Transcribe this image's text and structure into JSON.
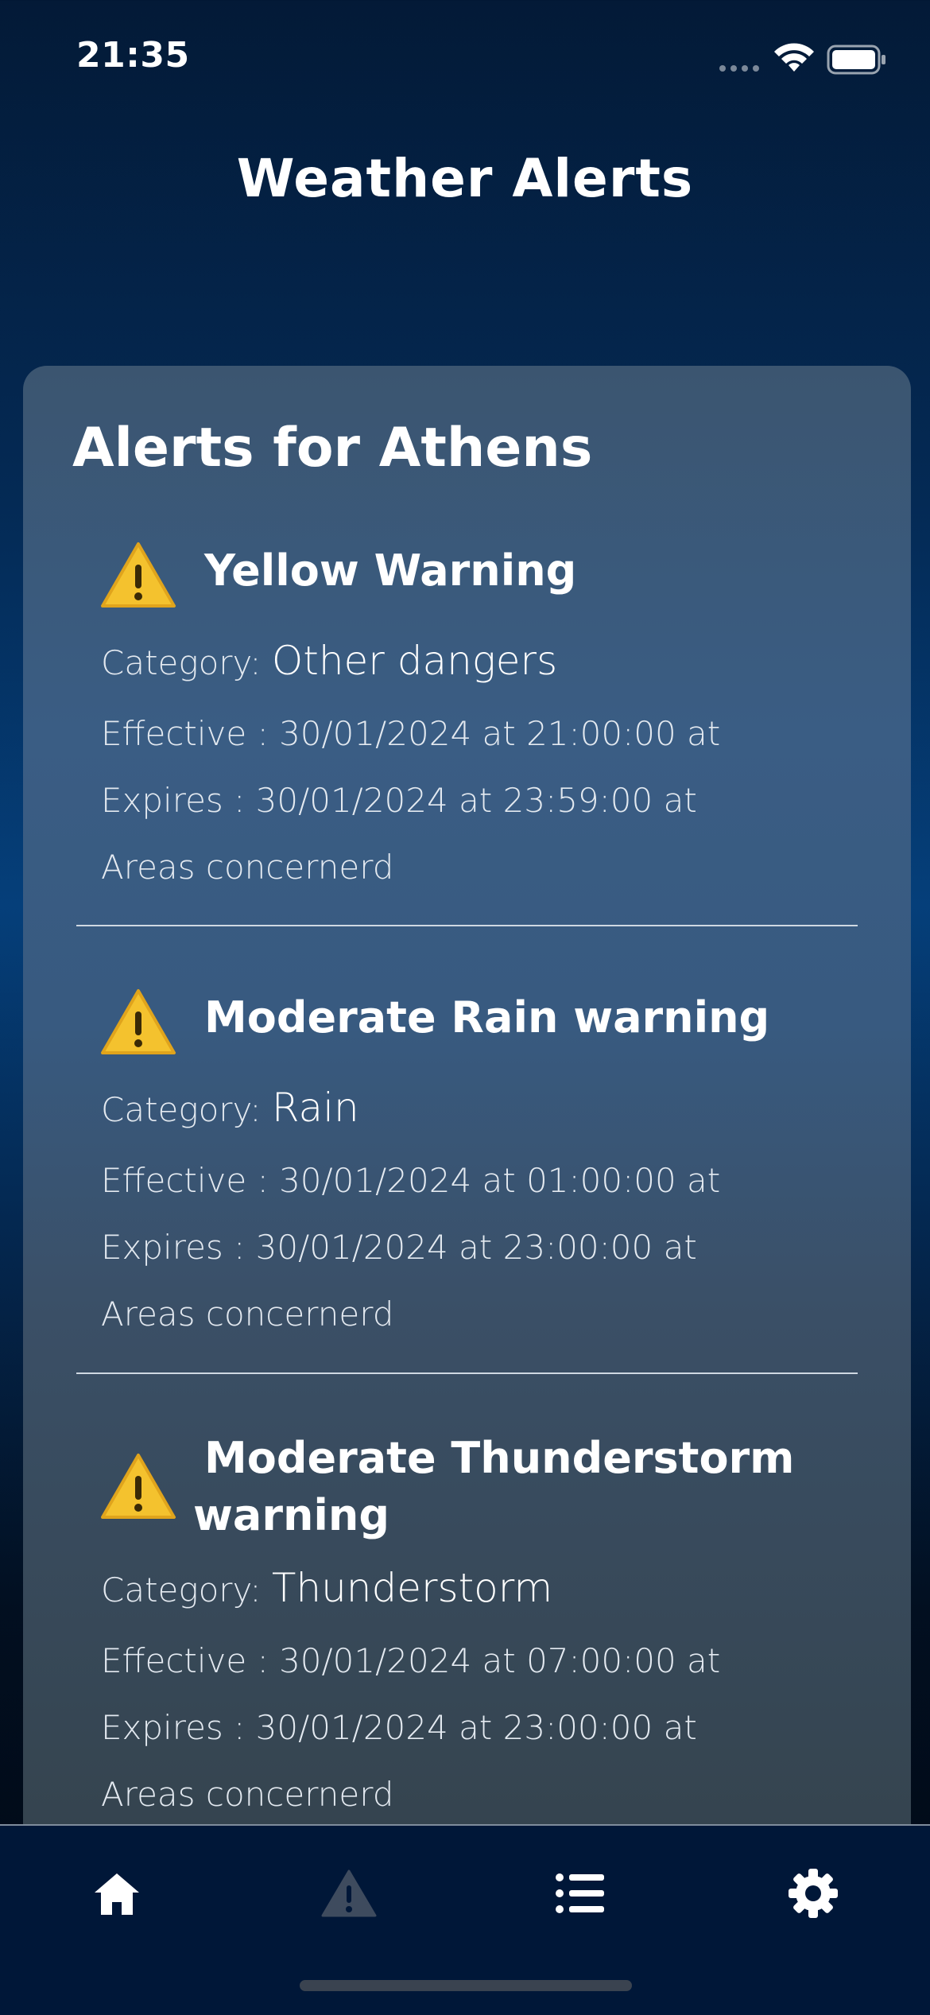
{
  "status_bar": {
    "time": "21:35",
    "icons": [
      "cellular-dots-icon",
      "wifi-icon",
      "battery-icon"
    ]
  },
  "header": {
    "title": "Weather Alerts"
  },
  "card": {
    "title": "Alerts for Athens",
    "labels": {
      "category": "Category:",
      "areas": "Areas concernerd"
    },
    "alerts": [
      {
        "title": "Yellow Warning",
        "category": "Other dangers",
        "effective": "Effective : 30/01/2024 at 21:00:00 at",
        "expires": "Expires : 30/01/2024 at 23:59:00 at",
        "areas": "Areas concernerd"
      },
      {
        "title": "Moderate Rain warning",
        "category": "Rain",
        "effective": "Effective : 30/01/2024 at 01:00:00 at",
        "expires": "Expires : 30/01/2024 at 23:00:00 at",
        "areas": "Areas concernerd"
      },
      {
        "title": "Moderate Thunderstorm warning",
        "category": "Thunderstorm",
        "effective": "Effective : 30/01/2024 at 07:00:00 at",
        "expires": "Expires : 30/01/2024 at 23:00:00 at",
        "areas": "Areas concernerd"
      }
    ]
  },
  "tab_bar": {
    "tabs": [
      {
        "icon": "home-icon",
        "active": true
      },
      {
        "icon": "warning-icon",
        "active": false
      },
      {
        "icon": "list-icon",
        "active": true
      },
      {
        "icon": "gear-icon",
        "active": true
      }
    ],
    "colors": {
      "active": "#ffffff",
      "inactive": "#3e4b5e",
      "warning_fill": "#f4c430"
    }
  }
}
